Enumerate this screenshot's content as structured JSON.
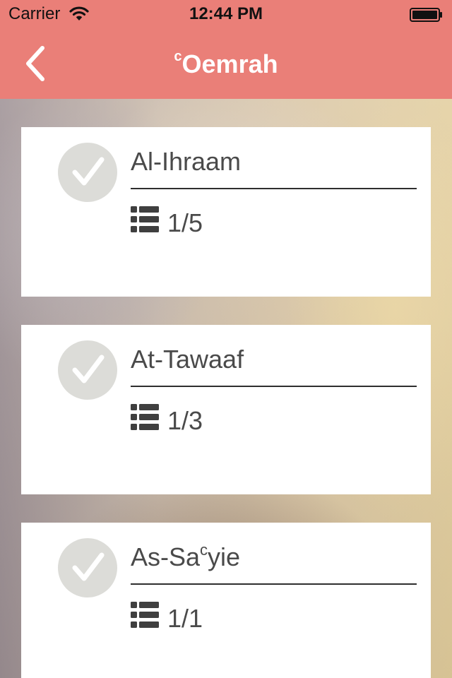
{
  "status_bar": {
    "carrier": "Carrier",
    "time": "12:44 PM",
    "wifi_icon": "wifi-icon",
    "battery_icon": "battery-full-icon"
  },
  "nav": {
    "back_icon": "chevron-left-icon",
    "title_sup": "c",
    "title_main": "Oemrah",
    "bar_color": "#ea7f78"
  },
  "steps": [
    {
      "title": "Al-Ihraam",
      "count": "1/5",
      "icon": "checkmark-icon"
    },
    {
      "title": "At-Tawaaf",
      "count": "1/3",
      "icon": "checkmark-icon"
    },
    {
      "title_pre": "As-Sa",
      "title_sup": "c",
      "title_post": "yie",
      "count": "1/1",
      "icon": "checkmark-icon"
    }
  ],
  "list_icon": "list-icon"
}
